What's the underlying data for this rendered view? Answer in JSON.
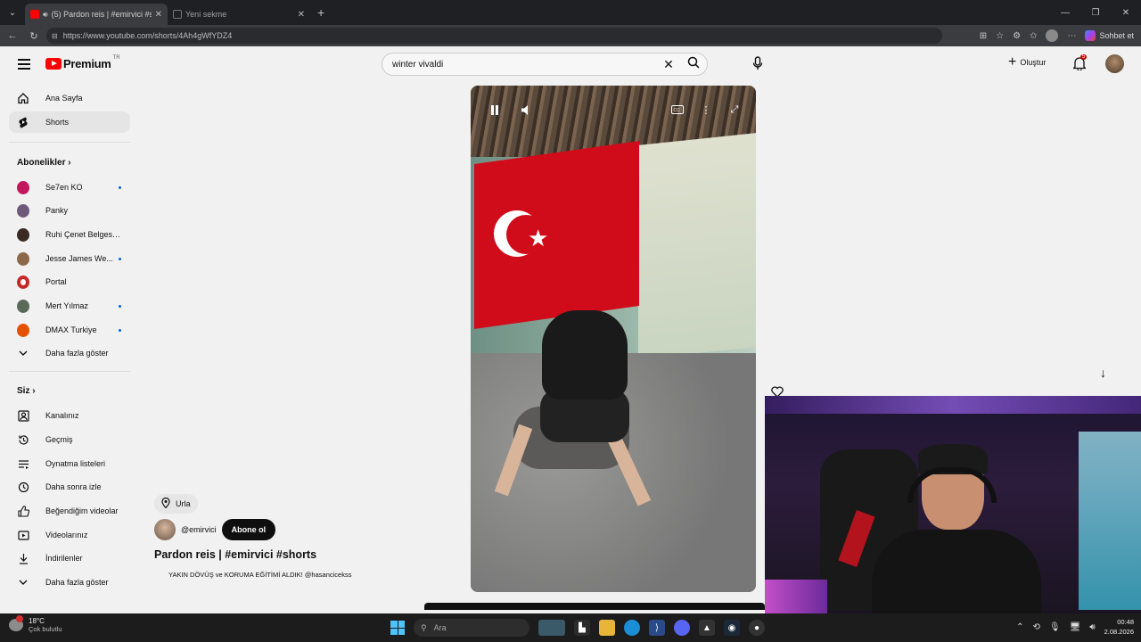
{
  "browser": {
    "tabs": [
      {
        "title": "(5) Pardon reis | #emirvici #sh",
        "active": true
      },
      {
        "title": "Yeni sekme",
        "active": false
      }
    ],
    "url": "https://www.youtube.com/shorts/4Ah4gWfYDZ4",
    "chat_label": "Sohbet et"
  },
  "youtube": {
    "brand": "Premium",
    "region": "TR",
    "search_query": "winter vivaldi",
    "create_label": "Oluştur",
    "notification_count": "5"
  },
  "sidebar": {
    "main": [
      {
        "label": "Ana Sayfa",
        "icon": "home-icon"
      },
      {
        "label": "Shorts",
        "icon": "shorts-icon",
        "active": true
      }
    ],
    "subscriptions_title": "Abonelikler",
    "subscriptions": [
      {
        "label": "Se7en KO",
        "dot": true,
        "color": "#c2185b"
      },
      {
        "label": "Panky",
        "dot": false,
        "color": "#6d5a7a"
      },
      {
        "label": "Ruhi Çenet Belgesel...",
        "dot": false,
        "color": "#3a2a22"
      },
      {
        "label": "Jesse James We...",
        "dot": true,
        "color": "#8a6a4a"
      },
      {
        "label": "Portal",
        "dot": false,
        "color": "#c62828"
      },
      {
        "label": "Mert Yılmaz",
        "dot": true,
        "color": "#5a6a5a"
      },
      {
        "label": "DMAX Turkiye",
        "dot": true,
        "color": "#e65100"
      }
    ],
    "show_more": "Daha fazla göster",
    "you_title": "Siz",
    "you": [
      {
        "label": "Kanalınız",
        "icon": "channel-icon"
      },
      {
        "label": "Geçmiş",
        "icon": "history-icon"
      },
      {
        "label": "Oynatma listeleri",
        "icon": "playlist-icon"
      },
      {
        "label": "Daha sonra izle",
        "icon": "watch-later-icon"
      },
      {
        "label": "Beğendiğim videolar",
        "icon": "like-icon"
      },
      {
        "label": "Videolarınız",
        "icon": "your-videos-icon"
      },
      {
        "label": "İndirilenler",
        "icon": "download-icon"
      },
      {
        "label": "Daha fazla göster",
        "icon": "chevron-down-icon"
      }
    ]
  },
  "short": {
    "location": "Urla",
    "channel": "@emirvici",
    "subscribe_label": "Abone ol",
    "title": "Pardon reis | #emirvici #shorts",
    "description": "YAKIN DÖVÜŞ ve KORUMA EĞİTİMİ ALDIK! @hasancicekss"
  },
  "taskbar": {
    "temperature": "18°C",
    "weather": "Çok bulutlu",
    "search_placeholder": "Ara",
    "time": "00:48",
    "date": "2.08.2026"
  }
}
